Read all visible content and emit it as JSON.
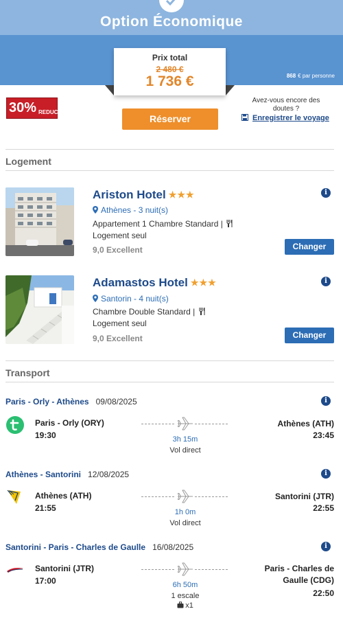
{
  "header": {
    "title": "Option Économique",
    "price_label": "Prix total",
    "price_old": "2 480  €",
    "price_new": "1 736 €",
    "per_person_amount": "868",
    "per_person_suffix": "€ par personne"
  },
  "promo": {
    "discount_pct": "30%",
    "discount_tag": "REDUC",
    "reserve_label": "Réserver",
    "doubts_text": "Avez-vous encore des doutes ?",
    "save_label": "Enregistrer le voyage"
  },
  "lodging": {
    "section_title": "Logement",
    "hotels": [
      {
        "name": "Ariston Hotel",
        "stars": "★★★",
        "location": "Athènes - 3 nuit(s)",
        "room": "Appartement 1 Chambre Standard |",
        "board": "Logement seul",
        "rating": "9,0 Excellent",
        "change_label": "Changer"
      },
      {
        "name": "Adamastos Hotel",
        "stars": "★★★",
        "location": "Santorin - 4 nuit(s)",
        "room": "Chambre Double Standard |",
        "board": "Logement seul",
        "rating": "9,0 Excellent",
        "change_label": "Changer"
      }
    ]
  },
  "transport": {
    "section_title": "Transport",
    "flights": [
      {
        "route": "Paris - Orly - Athènes",
        "date": "09/08/2025",
        "airline_icon": "transavia-logo",
        "dep_airport": "Paris - Orly (ORY)",
        "dep_time": "19:30",
        "arr_airport": "Athènes (ATH)",
        "arr_time": "23:45",
        "duration": "3h 15m",
        "stops": "Vol direct"
      },
      {
        "route": "Athènes - Santorini",
        "date": "12/08/2025",
        "airline_icon": "ryanair-logo",
        "dep_airport": "Athènes (ATH)",
        "dep_time": "21:55",
        "arr_airport": "Santorini (JTR)",
        "arr_time": "22:55",
        "duration": "1h 0m",
        "stops": "Vol direct"
      },
      {
        "route": "Santorini - Paris - Charles de Gaulle",
        "date": "16/08/2025",
        "airline_icon": "british-airways-logo",
        "dep_airport": "Santorini (JTR)",
        "dep_time": "17:00",
        "arr_airport": "Paris - Charles de Gaulle (CDG)",
        "arr_time": "22:50",
        "duration": "6h 50m",
        "stops": "1 escale",
        "bags": "x1"
      }
    ]
  },
  "colors": {
    "top_band": "#8db5df",
    "mid_band": "#5993d0",
    "accent_orange": "#ee8f2b",
    "link_blue": "#1d4a8a",
    "button_blue": "#2c6db5",
    "discount_red": "#c81e27"
  }
}
